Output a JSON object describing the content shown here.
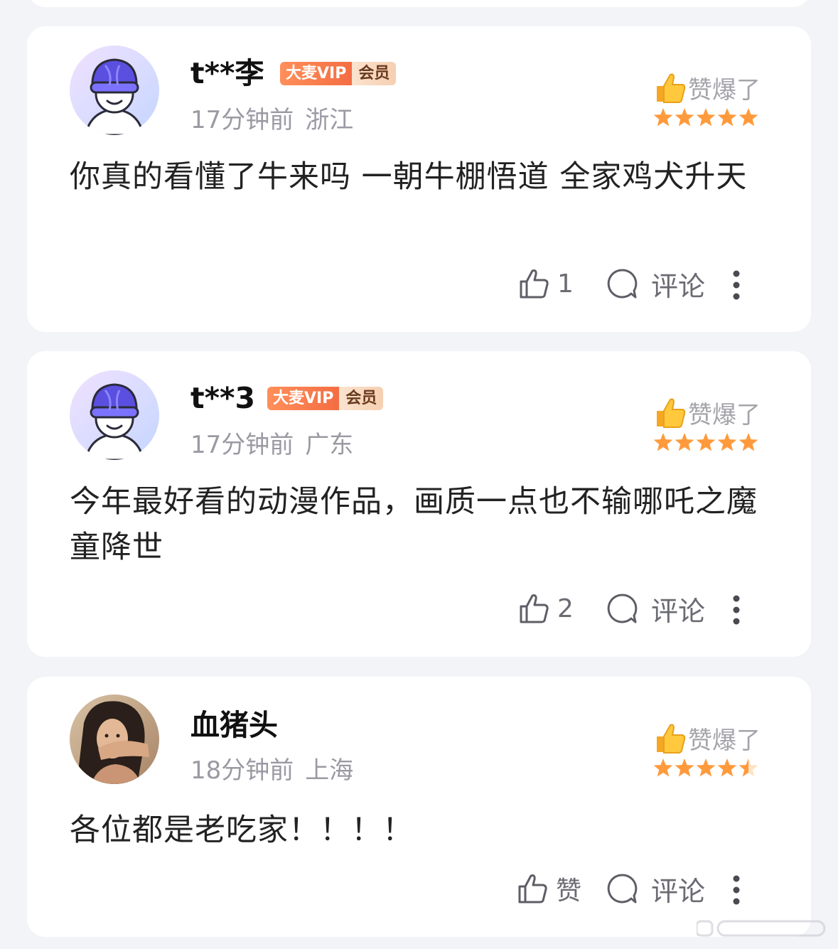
{
  "comments": [
    {
      "username": "t**李",
      "vip_label": "大麦VIP",
      "member_label": "会员",
      "time": "17分钟前",
      "location": "浙江",
      "rating_label": "赞爆了",
      "rating_stars": 5,
      "content": "你真的看懂了牛来吗 一朝牛棚悟道 全家鸡犬升天",
      "like_count": "1",
      "comment_label": "评论",
      "avatar": "cartoon-avatar"
    },
    {
      "username": "t**3",
      "vip_label": "大麦VIP",
      "member_label": "会员",
      "time": "17分钟前",
      "location": "广东",
      "rating_label": "赞爆了",
      "rating_stars": 5,
      "content": "今年最好看的动漫作品，画质一点也不输哪吒之魔童降世",
      "like_count": "2",
      "comment_label": "评论",
      "avatar": "cartoon-avatar"
    },
    {
      "username": "血猪头",
      "time": "18分钟前",
      "location": "上海",
      "rating_label": "赞爆了",
      "rating_stars": 4.5,
      "content": "各位都是老吃家！！！！",
      "like_count": "赞",
      "comment_label": "评论",
      "avatar": "photo-avatar"
    }
  ],
  "colors": {
    "background": "#f3f4f8",
    "card": "#ffffff",
    "star": "#ff9a3c",
    "vip_orange": "#f46d43",
    "meta_gray": "#9a9aa3"
  },
  "icons": [
    "thumbs-up-emoji-icon",
    "star-icon",
    "like-icon",
    "comment-icon",
    "more-icon"
  ]
}
